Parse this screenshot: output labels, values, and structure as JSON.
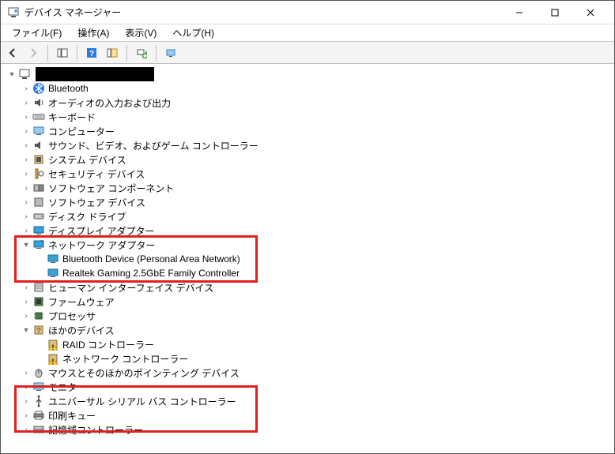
{
  "window": {
    "title": "デバイス マネージャー"
  },
  "menu": {
    "file": "ファイル(F)",
    "action": "操作(A)",
    "view": "表示(V)",
    "help": "ヘルプ(H)"
  },
  "tree": {
    "root": "",
    "bluetooth": "Bluetooth",
    "audio_io": "オーディオの入力および出力",
    "keyboard": "キーボード",
    "computer": "コンピューター",
    "sound_game": "サウンド、ビデオ、およびゲーム コントローラー",
    "system_devices": "システム デバイス",
    "security_devices": "セキュリティ デバイス",
    "software_components": "ソフトウェア コンポーネント",
    "software_devices": "ソフトウェア デバイス",
    "disk_drives": "ディスク ドライブ",
    "display_adapters": "ディスプレイ アダプター",
    "network_adapters": "ネットワーク アダプター",
    "net_bt_pan": "Bluetooth Device (Personal Area Network)",
    "net_realtek": "Realtek Gaming 2.5GbE Family Controller",
    "hid": "ヒューマン インターフェイス デバイス",
    "firmware": "ファームウェア",
    "processor": "プロセッサ",
    "other_devices": "ほかのデバイス",
    "other_raid": "RAID コントローラー",
    "other_network": "ネットワーク コントローラー",
    "mouse_pointing": "マウスとそのほかのポインティング デバイス",
    "monitors": "モニター",
    "usb_controllers": "ユニバーサル シリアル バス コントローラー",
    "print_queue": "印刷キュー",
    "storage_controllers": "記憶域コントローラー"
  },
  "colors": {
    "highlight_border": "#e02020"
  }
}
